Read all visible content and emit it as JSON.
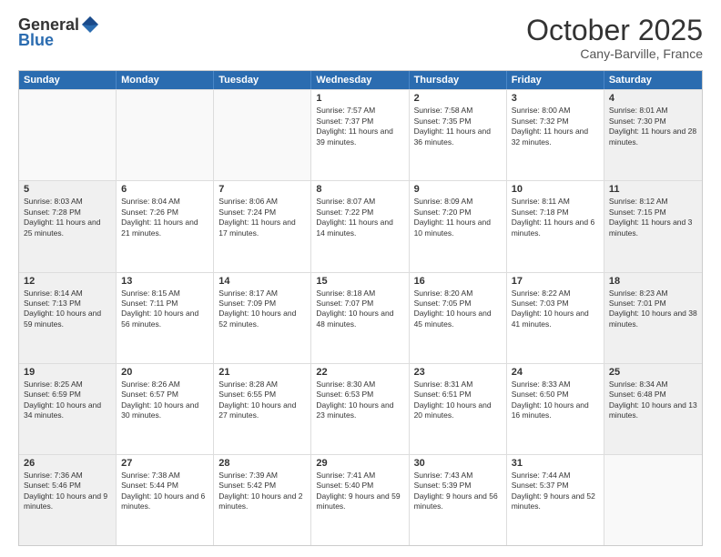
{
  "header": {
    "logo_general": "General",
    "logo_blue": "Blue",
    "month": "October 2025",
    "location": "Cany-Barville, France"
  },
  "days_of_week": [
    "Sunday",
    "Monday",
    "Tuesday",
    "Wednesday",
    "Thursday",
    "Friday",
    "Saturday"
  ],
  "rows": [
    [
      {
        "day": "",
        "sunrise": "",
        "sunset": "",
        "daylight": "",
        "shaded": false,
        "empty": true
      },
      {
        "day": "",
        "sunrise": "",
        "sunset": "",
        "daylight": "",
        "shaded": false,
        "empty": true
      },
      {
        "day": "",
        "sunrise": "",
        "sunset": "",
        "daylight": "",
        "shaded": false,
        "empty": true
      },
      {
        "day": "1",
        "sunrise": "Sunrise: 7:57 AM",
        "sunset": "Sunset: 7:37 PM",
        "daylight": "Daylight: 11 hours and 39 minutes.",
        "shaded": false,
        "empty": false
      },
      {
        "day": "2",
        "sunrise": "Sunrise: 7:58 AM",
        "sunset": "Sunset: 7:35 PM",
        "daylight": "Daylight: 11 hours and 36 minutes.",
        "shaded": false,
        "empty": false
      },
      {
        "day": "3",
        "sunrise": "Sunrise: 8:00 AM",
        "sunset": "Sunset: 7:32 PM",
        "daylight": "Daylight: 11 hours and 32 minutes.",
        "shaded": false,
        "empty": false
      },
      {
        "day": "4",
        "sunrise": "Sunrise: 8:01 AM",
        "sunset": "Sunset: 7:30 PM",
        "daylight": "Daylight: 11 hours and 28 minutes.",
        "shaded": true,
        "empty": false
      }
    ],
    [
      {
        "day": "5",
        "sunrise": "Sunrise: 8:03 AM",
        "sunset": "Sunset: 7:28 PM",
        "daylight": "Daylight: 11 hours and 25 minutes.",
        "shaded": true,
        "empty": false
      },
      {
        "day": "6",
        "sunrise": "Sunrise: 8:04 AM",
        "sunset": "Sunset: 7:26 PM",
        "daylight": "Daylight: 11 hours and 21 minutes.",
        "shaded": false,
        "empty": false
      },
      {
        "day": "7",
        "sunrise": "Sunrise: 8:06 AM",
        "sunset": "Sunset: 7:24 PM",
        "daylight": "Daylight: 11 hours and 17 minutes.",
        "shaded": false,
        "empty": false
      },
      {
        "day": "8",
        "sunrise": "Sunrise: 8:07 AM",
        "sunset": "Sunset: 7:22 PM",
        "daylight": "Daylight: 11 hours and 14 minutes.",
        "shaded": false,
        "empty": false
      },
      {
        "day": "9",
        "sunrise": "Sunrise: 8:09 AM",
        "sunset": "Sunset: 7:20 PM",
        "daylight": "Daylight: 11 hours and 10 minutes.",
        "shaded": false,
        "empty": false
      },
      {
        "day": "10",
        "sunrise": "Sunrise: 8:11 AM",
        "sunset": "Sunset: 7:18 PM",
        "daylight": "Daylight: 11 hours and 6 minutes.",
        "shaded": false,
        "empty": false
      },
      {
        "day": "11",
        "sunrise": "Sunrise: 8:12 AM",
        "sunset": "Sunset: 7:15 PM",
        "daylight": "Daylight: 11 hours and 3 minutes.",
        "shaded": true,
        "empty": false
      }
    ],
    [
      {
        "day": "12",
        "sunrise": "Sunrise: 8:14 AM",
        "sunset": "Sunset: 7:13 PM",
        "daylight": "Daylight: 10 hours and 59 minutes.",
        "shaded": true,
        "empty": false
      },
      {
        "day": "13",
        "sunrise": "Sunrise: 8:15 AM",
        "sunset": "Sunset: 7:11 PM",
        "daylight": "Daylight: 10 hours and 56 minutes.",
        "shaded": false,
        "empty": false
      },
      {
        "day": "14",
        "sunrise": "Sunrise: 8:17 AM",
        "sunset": "Sunset: 7:09 PM",
        "daylight": "Daylight: 10 hours and 52 minutes.",
        "shaded": false,
        "empty": false
      },
      {
        "day": "15",
        "sunrise": "Sunrise: 8:18 AM",
        "sunset": "Sunset: 7:07 PM",
        "daylight": "Daylight: 10 hours and 48 minutes.",
        "shaded": false,
        "empty": false
      },
      {
        "day": "16",
        "sunrise": "Sunrise: 8:20 AM",
        "sunset": "Sunset: 7:05 PM",
        "daylight": "Daylight: 10 hours and 45 minutes.",
        "shaded": false,
        "empty": false
      },
      {
        "day": "17",
        "sunrise": "Sunrise: 8:22 AM",
        "sunset": "Sunset: 7:03 PM",
        "daylight": "Daylight: 10 hours and 41 minutes.",
        "shaded": false,
        "empty": false
      },
      {
        "day": "18",
        "sunrise": "Sunrise: 8:23 AM",
        "sunset": "Sunset: 7:01 PM",
        "daylight": "Daylight: 10 hours and 38 minutes.",
        "shaded": true,
        "empty": false
      }
    ],
    [
      {
        "day": "19",
        "sunrise": "Sunrise: 8:25 AM",
        "sunset": "Sunset: 6:59 PM",
        "daylight": "Daylight: 10 hours and 34 minutes.",
        "shaded": true,
        "empty": false
      },
      {
        "day": "20",
        "sunrise": "Sunrise: 8:26 AM",
        "sunset": "Sunset: 6:57 PM",
        "daylight": "Daylight: 10 hours and 30 minutes.",
        "shaded": false,
        "empty": false
      },
      {
        "day": "21",
        "sunrise": "Sunrise: 8:28 AM",
        "sunset": "Sunset: 6:55 PM",
        "daylight": "Daylight: 10 hours and 27 minutes.",
        "shaded": false,
        "empty": false
      },
      {
        "day": "22",
        "sunrise": "Sunrise: 8:30 AM",
        "sunset": "Sunset: 6:53 PM",
        "daylight": "Daylight: 10 hours and 23 minutes.",
        "shaded": false,
        "empty": false
      },
      {
        "day": "23",
        "sunrise": "Sunrise: 8:31 AM",
        "sunset": "Sunset: 6:51 PM",
        "daylight": "Daylight: 10 hours and 20 minutes.",
        "shaded": false,
        "empty": false
      },
      {
        "day": "24",
        "sunrise": "Sunrise: 8:33 AM",
        "sunset": "Sunset: 6:50 PM",
        "daylight": "Daylight: 10 hours and 16 minutes.",
        "shaded": false,
        "empty": false
      },
      {
        "day": "25",
        "sunrise": "Sunrise: 8:34 AM",
        "sunset": "Sunset: 6:48 PM",
        "daylight": "Daylight: 10 hours and 13 minutes.",
        "shaded": true,
        "empty": false
      }
    ],
    [
      {
        "day": "26",
        "sunrise": "Sunrise: 7:36 AM",
        "sunset": "Sunset: 5:46 PM",
        "daylight": "Daylight: 10 hours and 9 minutes.",
        "shaded": true,
        "empty": false
      },
      {
        "day": "27",
        "sunrise": "Sunrise: 7:38 AM",
        "sunset": "Sunset: 5:44 PM",
        "daylight": "Daylight: 10 hours and 6 minutes.",
        "shaded": false,
        "empty": false
      },
      {
        "day": "28",
        "sunrise": "Sunrise: 7:39 AM",
        "sunset": "Sunset: 5:42 PM",
        "daylight": "Daylight: 10 hours and 2 minutes.",
        "shaded": false,
        "empty": false
      },
      {
        "day": "29",
        "sunrise": "Sunrise: 7:41 AM",
        "sunset": "Sunset: 5:40 PM",
        "daylight": "Daylight: 9 hours and 59 minutes.",
        "shaded": false,
        "empty": false
      },
      {
        "day": "30",
        "sunrise": "Sunrise: 7:43 AM",
        "sunset": "Sunset: 5:39 PM",
        "daylight": "Daylight: 9 hours and 56 minutes.",
        "shaded": false,
        "empty": false
      },
      {
        "day": "31",
        "sunrise": "Sunrise: 7:44 AM",
        "sunset": "Sunset: 5:37 PM",
        "daylight": "Daylight: 9 hours and 52 minutes.",
        "shaded": false,
        "empty": false
      },
      {
        "day": "",
        "sunrise": "",
        "sunset": "",
        "daylight": "",
        "shaded": true,
        "empty": true
      }
    ]
  ]
}
